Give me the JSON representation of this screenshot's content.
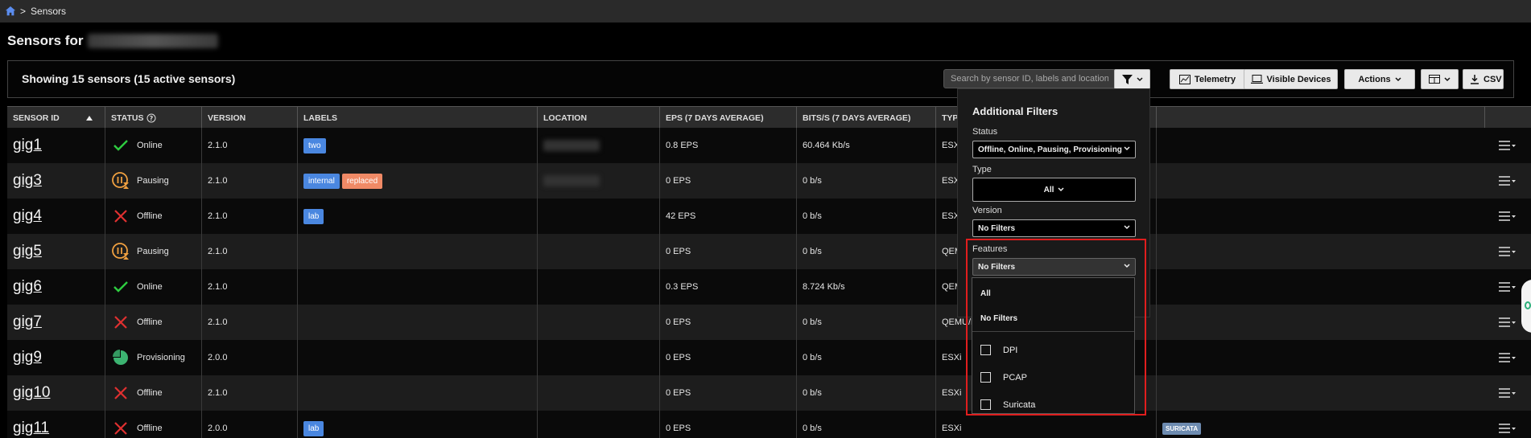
{
  "breadcrumb": {
    "separator": ">",
    "current": "Sensors"
  },
  "page": {
    "title": "Sensors for"
  },
  "toolbar": {
    "count_text": "Showing 15 sensors (15 active sensors)",
    "search_placeholder": "Search by sensor ID, labels and location",
    "telemetry_label": "Telemetry",
    "visible_devices_label": "Visible Devices",
    "actions_label": "Actions",
    "csv_label": "CSV"
  },
  "columns": [
    {
      "label": "SENSOR ID"
    },
    {
      "label": "STATUS"
    },
    {
      "label": "VERSION"
    },
    {
      "label": "LABELS"
    },
    {
      "label": "LOCATION"
    },
    {
      "label": "EPS (7 DAYS AVERAGE)"
    },
    {
      "label": "BITS/S (7 DAYS AVERAGE)"
    },
    {
      "label": "TYP"
    }
  ],
  "rows": [
    {
      "id": "gig1",
      "status": "Online",
      "version": "2.1.0",
      "labels": [
        "two"
      ],
      "eps": "0.8 EPS",
      "bits": "60.464 Kb/s",
      "type": "ESXi"
    },
    {
      "id": "gig3",
      "status": "Pausing",
      "version": "2.1.0",
      "labels": [
        "internal",
        "replaced"
      ],
      "eps": "0 EPS",
      "bits": "0 b/s",
      "type": "ESXi"
    },
    {
      "id": "gig4",
      "status": "Offline",
      "version": "2.1.0",
      "labels": [
        "lab"
      ],
      "eps": "42 EPS",
      "bits": "0 b/s",
      "type": "ESXi"
    },
    {
      "id": "gig5",
      "status": "Pausing",
      "version": "2.1.0",
      "labels": [],
      "eps": "0 EPS",
      "bits": "0 b/s",
      "type": "QEM"
    },
    {
      "id": "gig6",
      "status": "Online",
      "version": "2.1.0",
      "labels": [],
      "eps": "0.3 EPS",
      "bits": "8.724 Kb/s",
      "type": "QEM"
    },
    {
      "id": "gig7",
      "status": "Offline",
      "version": "2.1.0",
      "labels": [],
      "eps": "0 EPS",
      "bits": "0 b/s",
      "type": "QEMU/K"
    },
    {
      "id": "gig9",
      "status": "Provisioning",
      "version": "2.0.0",
      "labels": [],
      "eps": "0 EPS",
      "bits": "0 b/s",
      "type": "ESXi"
    },
    {
      "id": "gig10",
      "status": "Offline",
      "version": "2.1.0",
      "labels": [],
      "eps": "0 EPS",
      "bits": "0 b/s",
      "type": "ESXi"
    },
    {
      "id": "gig11",
      "status": "Offline",
      "version": "2.0.0",
      "labels": [
        "lab"
      ],
      "eps": "0 EPS",
      "bits": "0 b/s",
      "type": "ESXi",
      "feature": "SURICATA"
    }
  ],
  "filters": {
    "title": "Additional Filters",
    "status_label": "Status",
    "status_value": "Offline, Online, Pausing, Provisioning",
    "type_label": "Type",
    "type_value": "All",
    "version_label": "Version",
    "version_value": "No Filters",
    "features_label": "Features",
    "features_value": "No Filters",
    "features_options": {
      "all": "All",
      "none": "No Filters",
      "dpi": "DPI",
      "pcap": "PCAP",
      "suricata": "Suricata"
    }
  },
  "colors": {
    "online": "#2ecc40",
    "offline": "#e03030",
    "pausing": "#f0a040",
    "provisioning": "#3cb371",
    "label_blue": "#4a87e0",
    "label_orange": "#f08a66",
    "highlight": "#e01e1e"
  }
}
